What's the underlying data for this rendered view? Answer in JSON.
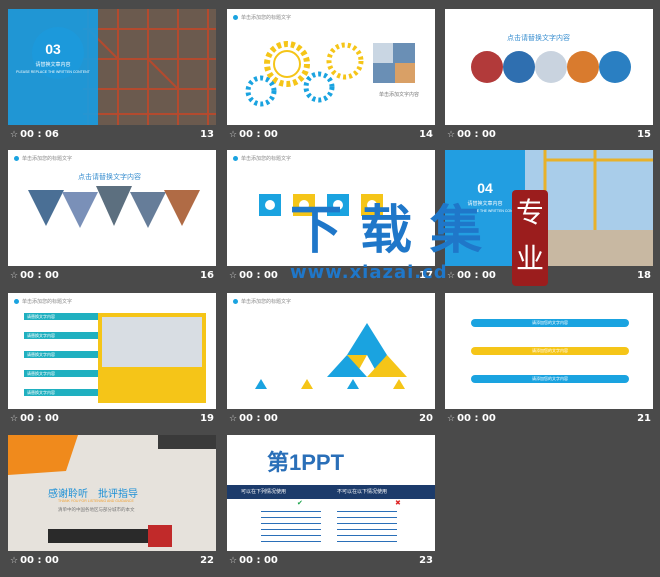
{
  "slides": [
    {
      "time": "00 : 06",
      "num": "13",
      "big": "03",
      "line1": "请替换文章内容",
      "line2": "PLEASE REPLACE THE WRITTEN CONTENT"
    },
    {
      "time": "00 : 00",
      "num": "14",
      "header": "单击添加您的标题文字"
    },
    {
      "time": "00 : 00",
      "num": "15",
      "header": "",
      "title": "点击请替换文字内容"
    },
    {
      "time": "00 : 00",
      "num": "16",
      "header": "单击添加您的标题文字",
      "title": "点击请替换文字内容"
    },
    {
      "time": "00 : 00",
      "num": "17",
      "header": "单击添加您的标题文字"
    },
    {
      "time": "00 : 00",
      "num": "18",
      "big": "04",
      "line1": "请替换文章内容",
      "line2": "PLEASE REPLACE THE WRITTEN CONTENT"
    },
    {
      "time": "00 : 00",
      "num": "19",
      "header": "单击添加您的标题文字",
      "bars": [
        "请替换文字内容",
        "请替换文字内容",
        "请替换文字内容",
        "请替换文字内容",
        "请替换文字内容"
      ]
    },
    {
      "time": "00 : 00",
      "num": "20",
      "header": "单击添加您的标题文字"
    },
    {
      "time": "00 : 00",
      "num": "21",
      "pills": [
        "请添加您的文字内容",
        "请添加您的文字内容",
        "请添加您的文字内容"
      ]
    },
    {
      "time": "00 : 00",
      "num": "22",
      "thanks": "感谢聆听　批评指导",
      "sub": "THANK YOU FOR LISTENING AND GUIDANCE",
      "footer": "清单中的中国各地区与部分城市的本文"
    },
    {
      "time": "00 : 00",
      "num": "23",
      "logo": "第1PPT",
      "col1": "可以在下列情况使用",
      "col2": "不可以在以下情况使用"
    }
  ],
  "watermark": {
    "chars": [
      "下",
      "载",
      "集"
    ],
    "url": "www.xiazai.cd",
    "seal": "专业"
  },
  "colors": {
    "blue": "#1aa3e0",
    "yellow": "#f5c518",
    "teal": "#1fb0c0",
    "dark": "#1c3b6b"
  }
}
